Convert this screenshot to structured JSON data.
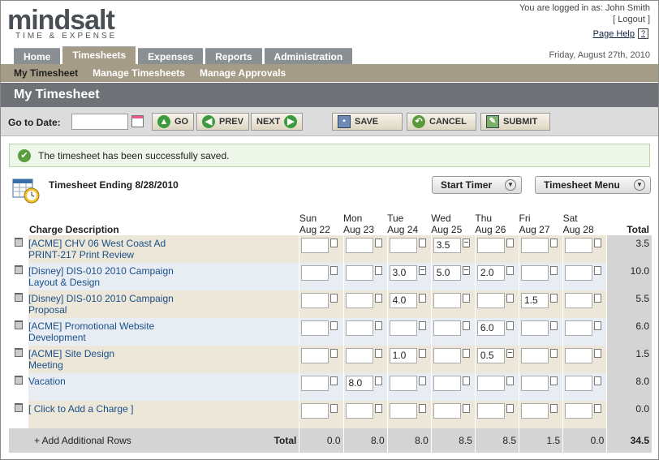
{
  "brand": {
    "name": "mindsalt",
    "tagline": "TIME & EXPENSE"
  },
  "user": {
    "logged_in_text": "You are logged in as: John Smith",
    "logout": "[ Logout ]",
    "page_help": "Page Help",
    "help_glyph": "?"
  },
  "date_display": "Friday, August 27th, 2010",
  "tabs": [
    {
      "label": "Home"
    },
    {
      "label": "Timesheets"
    },
    {
      "label": "Expenses"
    },
    {
      "label": "Reports"
    },
    {
      "label": "Administration"
    }
  ],
  "active_tab": "Timesheets",
  "subnav": [
    {
      "label": "My Timesheet"
    },
    {
      "label": "Manage Timesheets"
    },
    {
      "label": "Manage Approvals"
    }
  ],
  "page_title": "My Timesheet",
  "toolbar": {
    "goto_label": "Go to Date:",
    "goto_value": "",
    "go": "GO",
    "prev": "PREV",
    "next": "NEXT",
    "save": "SAVE",
    "cancel": "CANCEL",
    "submit": "SUBMIT"
  },
  "message": "The timesheet has been successfully saved.",
  "timesheet_ending": "Timesheet Ending 8/28/2010",
  "start_timer": "Start Timer",
  "timesheet_menu": "Timesheet Menu",
  "columns": {
    "desc": "Charge Description",
    "total": "Total",
    "days": [
      {
        "d": "Sun",
        "date": "Aug 22"
      },
      {
        "d": "Mon",
        "date": "Aug 23"
      },
      {
        "d": "Tue",
        "date": "Aug 24"
      },
      {
        "d": "Wed",
        "date": "Aug 25"
      },
      {
        "d": "Thu",
        "date": "Aug 26"
      },
      {
        "d": "Fri",
        "date": "Aug 27"
      },
      {
        "d": "Sat",
        "date": "Aug 28"
      }
    ]
  },
  "rows": [
    {
      "line1": "[ACME] CHV 06 West Coast Ad",
      "line2": "PRINT-217 Print Review",
      "hours": [
        "",
        "",
        "",
        "3.5",
        "",
        "",
        ""
      ],
      "notes": [
        false,
        false,
        false,
        true,
        false,
        false,
        false
      ],
      "total": "3.5"
    },
    {
      "line1": "[Disney] DIS-010 2010 Campaign",
      "line2": "Layout & Design",
      "hours": [
        "",
        "",
        "3.0",
        "5.0",
        "2.0",
        "",
        ""
      ],
      "notes": [
        false,
        false,
        true,
        true,
        false,
        false,
        false
      ],
      "total": "10.0"
    },
    {
      "line1": "[Disney] DIS-010 2010 Campaign",
      "line2": "Proposal",
      "hours": [
        "",
        "",
        "4.0",
        "",
        "",
        "1.5",
        ""
      ],
      "notes": [
        false,
        false,
        false,
        false,
        false,
        false,
        false
      ],
      "total": "5.5"
    },
    {
      "line1": "[ACME] Promotional Website",
      "line2": "Development",
      "hours": [
        "",
        "",
        "",
        "",
        "6.0",
        "",
        ""
      ],
      "notes": [
        false,
        false,
        false,
        false,
        false,
        false,
        false
      ],
      "total": "6.0"
    },
    {
      "line1": "[ACME] Site Design",
      "line2": "Meeting",
      "hours": [
        "",
        "",
        "1.0",
        "",
        "0.5",
        "",
        ""
      ],
      "notes": [
        false,
        false,
        false,
        false,
        true,
        false,
        false
      ],
      "total": "1.5"
    },
    {
      "line1": "Vacation",
      "line2": "",
      "hours": [
        "",
        "8.0",
        "",
        "",
        "",
        "",
        ""
      ],
      "notes": [
        false,
        false,
        false,
        false,
        false,
        false,
        false
      ],
      "total": "8.0"
    },
    {
      "line1": "[ Click to Add a Charge ]",
      "line2": "",
      "hours": [
        "",
        "",
        "",
        "",
        "",
        "",
        ""
      ],
      "notes": [
        false,
        false,
        false,
        false,
        false,
        false,
        false
      ],
      "total": "0.0",
      "add": true
    }
  ],
  "footer": {
    "add_rows": "+ Add Additional Rows",
    "total_label": "Total",
    "day_totals": [
      "0.0",
      "8.0",
      "8.0",
      "8.5",
      "8.5",
      "1.5",
      "0.0"
    ],
    "grand_total": "34.5"
  }
}
